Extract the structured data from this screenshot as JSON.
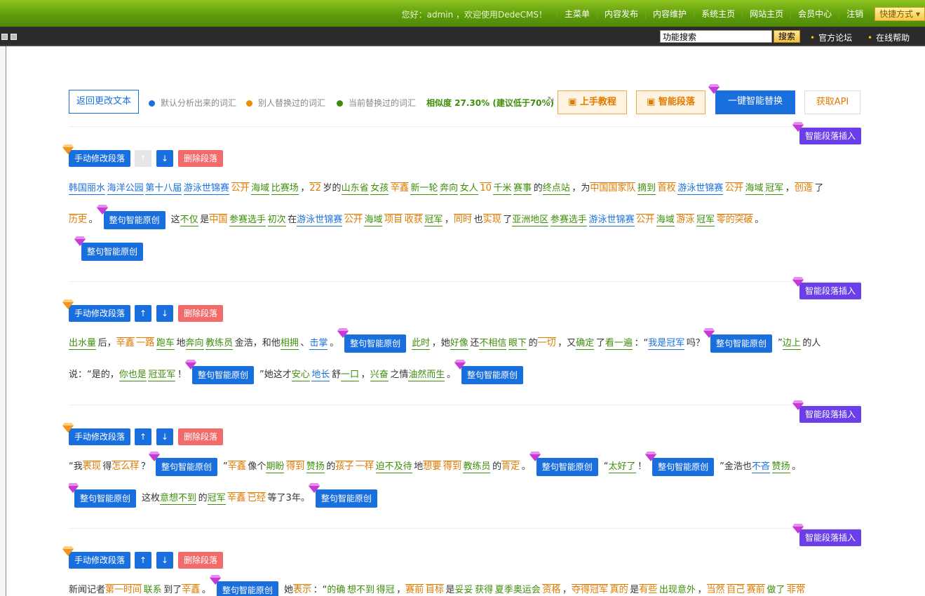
{
  "topnav": {
    "greeting": "您好：admin ，欢迎使用DedeCMS！",
    "items": [
      "主菜单",
      "内容发布",
      "内容维护",
      "系统主页",
      "网站主页",
      "会员中心",
      "注销"
    ],
    "quick": "快捷方式"
  },
  "subbar": {
    "search_value": "功能搜索",
    "search_button": "搜索",
    "forum": "官方论坛",
    "help": "在线帮助"
  },
  "toolbar": {
    "back": "返回更改文本",
    "legend": [
      {
        "label": "默认分析出来的词汇",
        "color": "#1a6fde"
      },
      {
        "label": "别人替换过的词汇",
        "color": "#f08a00"
      },
      {
        "label": "当前替换过的词汇",
        "color": "#3e8e0a"
      }
    ],
    "similarity": "相似度 27.30% (建议低于70%)",
    "tutorial": "上手教程",
    "smart_para": "智能段落",
    "one_key": "一键智能替换",
    "api": "获取API"
  },
  "para_buttons": {
    "insert": "智能段落插入",
    "manual": "手动修改段落",
    "up": "↑",
    "down": "↓",
    "delete": "删除段落",
    "original": "整句智能原创"
  },
  "paragraphs": [
    {
      "lines": [
        [
          [
            "b",
            "韩国丽水"
          ],
          [
            "b",
            "海洋公园"
          ],
          [
            "b",
            "第十八届"
          ],
          [
            "b",
            "游泳世锦赛"
          ],
          [
            "o",
            "公开"
          ],
          [
            "g",
            "海域"
          ],
          [
            "g",
            "比赛场"
          ],
          [
            "t",
            "，"
          ],
          [
            "o",
            "22"
          ],
          [
            "t",
            "岁的"
          ],
          [
            "g",
            "山东省"
          ],
          [
            "g",
            "女孩"
          ],
          [
            "o",
            "辛鑫"
          ],
          [
            "g",
            "新一轮"
          ],
          [
            "g",
            "奔向"
          ],
          [
            "g",
            "女人"
          ],
          [
            "o",
            "10"
          ],
          [
            "g",
            "千米"
          ],
          [
            "g",
            "赛事"
          ],
          [
            "t",
            "的"
          ],
          [
            "g",
            "终点站"
          ],
          [
            "t",
            "，为"
          ],
          [
            "o",
            "中国国家队"
          ],
          [
            "g",
            "摘到"
          ],
          [
            "o",
            "首枚"
          ],
          [
            "b",
            "游泳世锦赛"
          ],
          [
            "o",
            "公开"
          ],
          [
            "g",
            "海域"
          ],
          [
            "g",
            "冠军"
          ],
          [
            "t",
            "，"
          ],
          [
            "o",
            "创造"
          ],
          [
            "t",
            "了"
          ]
        ],
        [
          [
            "o",
            "历史"
          ],
          [
            "t",
            "。"
          ],
          [
            "btn",
            ""
          ],
          [
            "t",
            "这"
          ],
          [
            "g",
            "不仅"
          ],
          [
            "t",
            "是"
          ],
          [
            "o",
            "中国"
          ],
          [
            "g",
            "参赛选手"
          ],
          [
            "g",
            "初次"
          ],
          [
            "t",
            "在"
          ],
          [
            "b",
            "游泳世锦赛"
          ],
          [
            "o",
            "公开"
          ],
          [
            "g",
            "海域"
          ],
          [
            "o",
            "项目"
          ],
          [
            "o",
            "收获"
          ],
          [
            "g",
            "冠军"
          ],
          [
            "t",
            "，"
          ],
          [
            "o",
            "同时"
          ],
          [
            "t",
            "也"
          ],
          [
            "o",
            "实现"
          ],
          [
            "t",
            "了"
          ],
          [
            "g",
            "亚洲地区"
          ],
          [
            "g",
            "参赛选手"
          ],
          [
            "b",
            "游泳世锦赛"
          ],
          [
            "o",
            "公开"
          ],
          [
            "g",
            "海域"
          ],
          [
            "o",
            "游泳"
          ],
          [
            "g",
            "冠军"
          ],
          [
            "o",
            "零的突破"
          ],
          [
            "t",
            "。"
          ]
        ],
        [
          [
            "btn",
            ""
          ]
        ]
      ]
    },
    {
      "lines": [
        [
          [
            "g",
            "出水量"
          ],
          [
            "t",
            "后，"
          ],
          [
            "o",
            "辛鑫"
          ],
          [
            "o",
            "一路"
          ],
          [
            "g",
            "跑车"
          ],
          [
            "t",
            "地"
          ],
          [
            "g",
            "奔向"
          ],
          [
            "g",
            "教练员"
          ],
          [
            "t",
            "金浩，和他"
          ],
          [
            "g",
            "相拥"
          ],
          [
            "t",
            "、"
          ],
          [
            "b",
            "击掌"
          ],
          [
            "t",
            "。"
          ],
          [
            "btn",
            ""
          ],
          [
            "g",
            "此时"
          ],
          [
            "t",
            "，她"
          ],
          [
            "g",
            "好像"
          ],
          [
            "t",
            "还"
          ],
          [
            "g",
            "不相信"
          ],
          [
            "g",
            "眼下"
          ],
          [
            "t",
            "的"
          ],
          [
            "o",
            "一切"
          ],
          [
            "t",
            "，又"
          ],
          [
            "g",
            "确定"
          ],
          [
            "t",
            "了"
          ],
          [
            "g",
            "看一遍"
          ],
          [
            "t",
            "：“"
          ],
          [
            "b",
            "我是冠军"
          ],
          [
            "t",
            "吗？"
          ],
          [
            "btn",
            ""
          ],
          [
            "t",
            "”"
          ],
          [
            "g",
            "边上"
          ],
          [
            "t",
            "的人"
          ]
        ],
        [
          [
            "t",
            "说：“是的，"
          ],
          [
            "g",
            "你也是"
          ],
          [
            "g",
            "冠亚军"
          ],
          [
            "t",
            "！"
          ],
          [
            "btn",
            ""
          ],
          [
            "t",
            "”她这才"
          ],
          [
            "g",
            "安心"
          ],
          [
            "b",
            "地长"
          ],
          [
            "t",
            "舒"
          ],
          [
            "g",
            "一口"
          ],
          [
            "t",
            "，"
          ],
          [
            "g",
            "兴奋"
          ],
          [
            "t",
            "之情"
          ],
          [
            "g",
            "油然而生"
          ],
          [
            "t",
            "。"
          ],
          [
            "btn",
            ""
          ]
        ]
      ]
    },
    {
      "lines": [
        [
          [
            "t",
            "“我"
          ],
          [
            "o",
            "表现"
          ],
          [
            "t",
            "得"
          ],
          [
            "o",
            "怎么样"
          ],
          [
            "t",
            "？"
          ],
          [
            "btn",
            ""
          ],
          [
            "t",
            "”"
          ],
          [
            "o",
            "辛鑫"
          ],
          [
            "t",
            "像个"
          ],
          [
            "g",
            "期盼"
          ],
          [
            "o",
            "得到"
          ],
          [
            "g",
            "赞扬"
          ],
          [
            "t",
            "的"
          ],
          [
            "o",
            "孩子"
          ],
          [
            "o",
            "一样"
          ],
          [
            "g",
            "迫不及待"
          ],
          [
            "t",
            "地"
          ],
          [
            "o",
            "想要"
          ],
          [
            "o",
            "得到"
          ],
          [
            "g",
            "教练员"
          ],
          [
            "t",
            "的"
          ],
          [
            "o",
            "肯定"
          ],
          [
            "t",
            "。"
          ],
          [
            "btn",
            ""
          ],
          [
            "t",
            "“"
          ],
          [
            "g",
            "太好了"
          ],
          [
            "t",
            "！"
          ],
          [
            "btn",
            ""
          ],
          [
            "t",
            "”金浩也"
          ],
          [
            "b",
            "不吝"
          ],
          [
            "g",
            "赞扬"
          ],
          [
            "t",
            "。"
          ]
        ],
        [
          [
            "btn",
            ""
          ],
          [
            "t",
            "这枚"
          ],
          [
            "g",
            "意想不到"
          ],
          [
            "t",
            "的"
          ],
          [
            "g",
            "冠军"
          ],
          [
            "o",
            "辛鑫"
          ],
          [
            "o",
            "已经"
          ],
          [
            "t",
            "等了3年。"
          ],
          [
            "btn",
            ""
          ]
        ]
      ]
    },
    {
      "lines": [
        [
          [
            "t",
            "新闻记者"
          ],
          [
            "o",
            "第一时间"
          ],
          [
            "g",
            "联系"
          ],
          [
            "t",
            "到了"
          ],
          [
            "o",
            "辛鑫"
          ],
          [
            "t",
            "。"
          ],
          [
            "btn",
            ""
          ],
          [
            "t",
            "她"
          ],
          [
            "o",
            "表示"
          ],
          [
            "t",
            "：“"
          ],
          [
            "g",
            "的确"
          ],
          [
            "g",
            "想不到"
          ],
          [
            "g",
            "得冠"
          ],
          [
            "t",
            "，"
          ],
          [
            "o",
            "赛前"
          ],
          [
            "o",
            "目标"
          ],
          [
            "t",
            "是"
          ],
          [
            "g",
            "妥妥"
          ],
          [
            "g",
            "获得"
          ],
          [
            "g",
            "夏季奥运会"
          ],
          [
            "o",
            "资格"
          ],
          [
            "t",
            "，"
          ],
          [
            "o",
            "夺得冠军"
          ],
          [
            "o",
            "真的"
          ],
          [
            "t",
            "是"
          ],
          [
            "o",
            "有些"
          ],
          [
            "g",
            "出现意外"
          ],
          [
            "t",
            "，"
          ],
          [
            "o",
            "当然"
          ],
          [
            "o",
            "自己"
          ],
          [
            "o",
            "赛前"
          ],
          [
            "g",
            "做了"
          ],
          [
            "o",
            "非常"
          ]
        ]
      ]
    }
  ]
}
